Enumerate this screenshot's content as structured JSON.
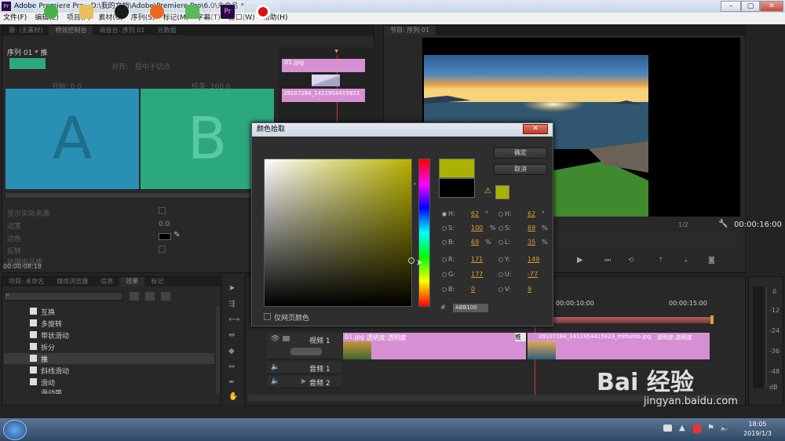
{
  "window": {
    "title": "Adobe Premiere Pro - D:\\我的文档\\Adobe\\Premiere Pro\\6.0\\未命名 *",
    "app_icon": "Pr"
  },
  "menu": [
    "文件(F)",
    "编辑(E)",
    "项目(P)",
    "素材(C)",
    "序列(S)",
    "标记(M)",
    "字幕(T)",
    "窗口(W)",
    "帮助(H)"
  ],
  "source_panel": {
    "tabs": [
      "源: (无素材)",
      "特效控制台",
      "调音台: 序列 01",
      "元数据"
    ],
    "sequence_label": "序列 01 * 推",
    "align_label": "对齐:",
    "align_value": "居中于切点",
    "start_label": "开始: 0.0",
    "end_label": "结束: 100.0",
    "clip_a": "A",
    "clip_b": "B",
    "clip_name_top": "01.jpg",
    "clip_name_bottom": "39107284_1411954415923",
    "props": [
      "显示实际来源",
      "边宽",
      "边色",
      "反转",
      "抗锯齿品质"
    ],
    "border_width_value": "0.0",
    "timecode": "00:00:08:18"
  },
  "project_panel": {
    "tabs": [
      "项目: 未命名",
      "媒体浏览器",
      "信息",
      "效果",
      "标记"
    ],
    "effects": [
      "互换",
      "多旋转",
      "带状滑动",
      "拆分",
      "推",
      "斜线滑动",
      "滑动",
      "滑动带"
    ]
  },
  "program_panel": {
    "tab": "节目: 序列 01",
    "zoom": "1/2",
    "timecode": "00:00:16:00"
  },
  "timeline": {
    "ruler": [
      "00:00:10:00",
      "00:00:15:00"
    ],
    "video_track": "视频 1",
    "audio_tracks": [
      "音频 1",
      "音频 2"
    ],
    "clip1": "01.jpg",
    "clip1_fx": "透明度:透明度",
    "transition": "推",
    "clip2": "39107284_1411954415923_mthumb.jpg",
    "clip2_fx": "透明度:透明度"
  },
  "meter": [
    "0",
    "-12",
    "-24",
    "-36",
    "-48",
    "dB"
  ],
  "color_picker": {
    "title": "颜色拾取",
    "ok": "确定",
    "cancel": "取消",
    "hex_label": "#",
    "hex": "ABB100",
    "web_only": "仅网页颜色",
    "left_fields": [
      {
        "label": "H:",
        "value": "62",
        "unit": "°"
      },
      {
        "label": "S:",
        "value": "100",
        "unit": "%"
      },
      {
        "label": "B:",
        "value": "69",
        "unit": "%"
      },
      {
        "label": "R:",
        "value": "171",
        "unit": ""
      },
      {
        "label": "G:",
        "value": "177",
        "unit": ""
      },
      {
        "label": "B:",
        "value": "0",
        "unit": ""
      }
    ],
    "right_fields": [
      {
        "label": "H:",
        "value": "62",
        "unit": "°"
      },
      {
        "label": "S:",
        "value": "69",
        "unit": "%"
      },
      {
        "label": "L:",
        "value": "35",
        "unit": "%"
      },
      {
        "label": "Y:",
        "value": "149",
        "unit": ""
      },
      {
        "label": "U:",
        "value": "-77",
        "unit": ""
      },
      {
        "label": "V:",
        "value": "9",
        "unit": ""
      }
    ],
    "colors": {
      "new": "#abb100",
      "old": "#000000"
    }
  },
  "clock": {
    "time": "18:05",
    "date": "2019/1/3"
  },
  "watermark": {
    "logo": "Bai 经验",
    "url": "jingyan.baidu.com"
  }
}
